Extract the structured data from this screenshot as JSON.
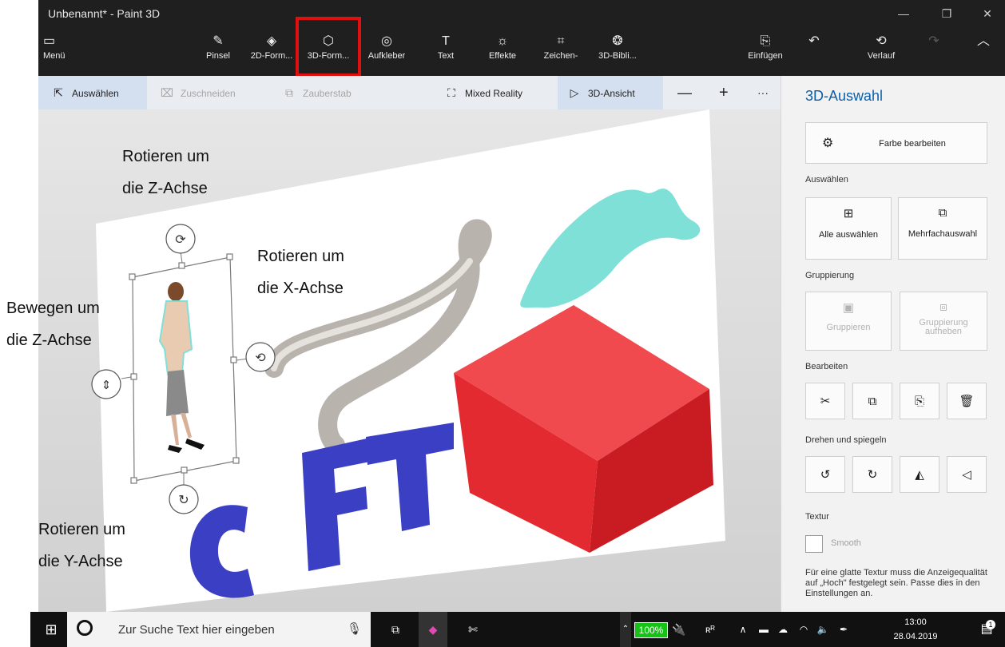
{
  "window": {
    "title": "Unbenannt* - Paint 3D",
    "controls": [
      "—",
      "❐",
      "✕"
    ]
  },
  "toolbar": {
    "menu": "Menü",
    "tools": [
      {
        "label": "Pinsel",
        "icon": "brush-icon"
      },
      {
        "label": "2D-Form...",
        "icon": "2d-shapes-icon"
      },
      {
        "label": "3D-Form...",
        "icon": "3d-shapes-icon"
      },
      {
        "label": "Aufkleber",
        "icon": "sticker-icon"
      },
      {
        "label": "Text",
        "icon": "text-icon"
      },
      {
        "label": "Effekte",
        "icon": "effects-icon"
      },
      {
        "label": "Zeichen-",
        "icon": "canvas-icon"
      },
      {
        "label": "3D-Bibli...",
        "icon": "3d-library-icon"
      }
    ],
    "insert": "Einfügen",
    "history": "Verlauf"
  },
  "subbar": {
    "select": "Auswählen",
    "crop": "Zuschneiden",
    "magic": "Zauberstab",
    "mixed_reality": "Mixed Reality",
    "view3d": "3D-Ansicht",
    "minus": "—",
    "plus": "+",
    "more": "···"
  },
  "panel": {
    "title": "3D-Auswahl",
    "edit_color": "Farbe bearbeiten",
    "select_section": "Auswählen",
    "select_all": "Alle auswählen",
    "multi_select": "Mehrfachauswahl",
    "group_section": "Gruppierung",
    "group": "Gruppieren",
    "ungroup": "Gruppierung aufheben",
    "edit_section": "Bearbeiten",
    "rotate_section": "Drehen und spiegeln",
    "texture_section": "Textur",
    "smooth": "Smooth",
    "note": "Für eine glatte Textur muss die Anzeigequalität auf „Hoch\" festgelegt sein. Passe dies in den Einstellungen an."
  },
  "annotations": {
    "z_rotate": [
      "Rotieren um",
      "die Z-Achse"
    ],
    "x_rotate": [
      "Rotieren um",
      "die X-Achse"
    ],
    "z_move": [
      "Bewegen um",
      "die Z-Achse"
    ],
    "y_rotate": [
      "Rotieren um",
      "die Y-Achse"
    ]
  },
  "taskbar": {
    "search_placeholder": "Zur Suche Text hier eingeben",
    "battery": "100%",
    "time": "13:00",
    "date": "28.04.2019",
    "notification_count": "1"
  },
  "colors": {
    "accent": "#0c5fa8",
    "highlight": "#e01010",
    "cube": "#f0343a",
    "letters": "#3b3fc4",
    "blob": "#7fe0d8"
  }
}
